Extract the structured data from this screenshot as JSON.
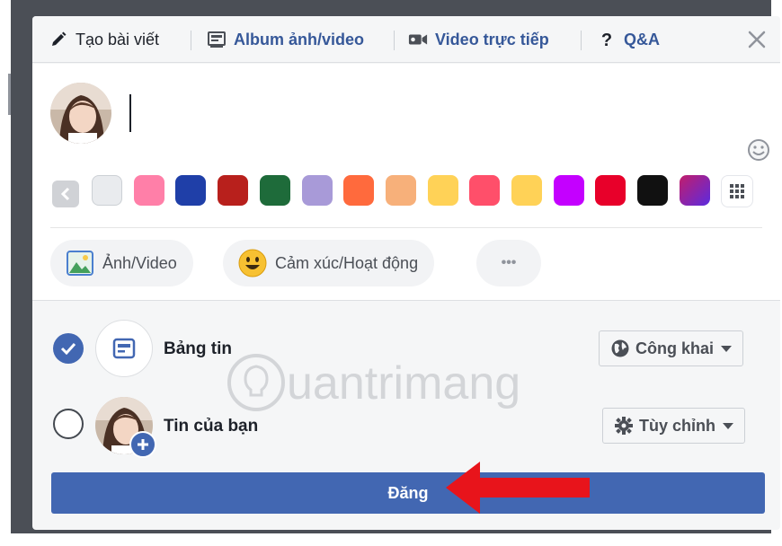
{
  "tabs": [
    {
      "label": "Tạo bài viết",
      "icon": "pencil-icon",
      "active": true
    },
    {
      "label": "Album ảnh/video",
      "icon": "photo-album-icon",
      "active": false
    },
    {
      "label": "Video trực tiếp",
      "icon": "video-camera-icon",
      "active": false
    },
    {
      "label": "Q&A",
      "icon": "question-mark-icon",
      "active": false
    }
  ],
  "close_icon": "close-icon",
  "composer": {
    "text_value": "",
    "emoji_icon": "smiley-icon"
  },
  "backgrounds": {
    "swatch_colors": [
      "#e9ebee",
      "#ff7fa8",
      "#1f3fa8",
      "#b8201c",
      "#1e6b3a",
      "#a89ad8",
      "#ff6a3d",
      "#f7b07a",
      "#ffd257",
      "#ff4f6a",
      "#ffd257",
      "#c400ff",
      "#e8002a",
      "#111111",
      "#8b2fd6"
    ]
  },
  "actions": [
    {
      "label": "Ảnh/Video",
      "icon": "photo-icon"
    },
    {
      "label": "Cảm xúc/Hoạt động",
      "icon": "grinning-face-icon"
    },
    {
      "label": "•••",
      "icon": "more-icon"
    }
  ],
  "destinations": [
    {
      "label": "Bảng tin",
      "checked": true,
      "privacy": "Công khai",
      "privacy_icon": "globe-icon"
    },
    {
      "label": "Tin của bạn",
      "checked": false,
      "privacy": "Tùy chỉnh",
      "privacy_icon": "gear-icon"
    }
  ],
  "post_button": {
    "label": "Đăng"
  },
  "watermark": {
    "text": "uantrimang"
  },
  "colors": {
    "brand_blue": "#4267b2",
    "link_blue": "#365899",
    "arrow_red": "#e8141b"
  }
}
